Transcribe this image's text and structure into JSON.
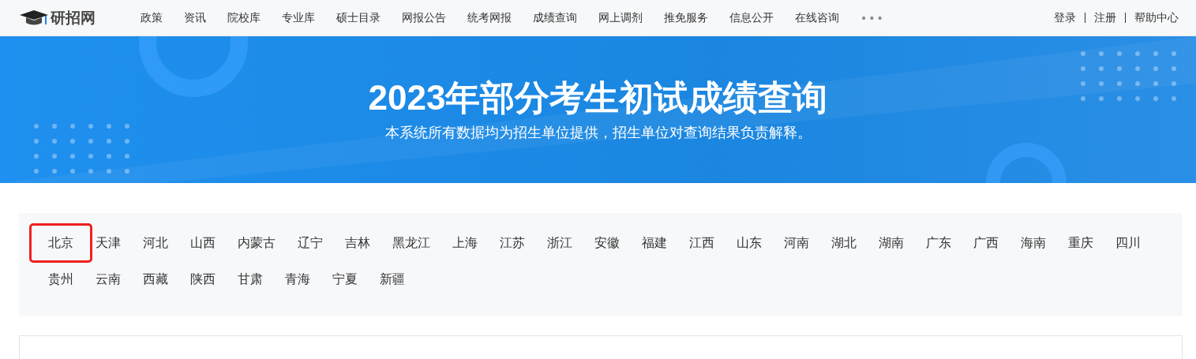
{
  "header": {
    "logo_text": "研招网",
    "nav": [
      "政策",
      "资讯",
      "院校库",
      "专业库",
      "硕士目录",
      "网报公告",
      "统考网报",
      "成绩查询",
      "网上调剂",
      "推免服务",
      "信息公开",
      "在线咨询"
    ],
    "more": "•••",
    "account_links": [
      "登录",
      "注册",
      "帮助中心"
    ]
  },
  "banner": {
    "title": "2023年部分考生初试成绩查询",
    "subtitle": "本系统所有数据均为招生单位提供，招生单位对查询结果负责解释。"
  },
  "regions": [
    {
      "name": "北京",
      "highlighted": true
    },
    {
      "name": "天津",
      "highlighted": false
    },
    {
      "name": "河北",
      "highlighted": false
    },
    {
      "name": "山西",
      "highlighted": false
    },
    {
      "name": "内蒙古",
      "highlighted": false
    },
    {
      "name": "辽宁",
      "highlighted": false
    },
    {
      "name": "吉林",
      "highlighted": false
    },
    {
      "name": "黑龙江",
      "highlighted": false
    },
    {
      "name": "上海",
      "highlighted": false
    },
    {
      "name": "江苏",
      "highlighted": false
    },
    {
      "name": "浙江",
      "highlighted": false
    },
    {
      "name": "安徽",
      "highlighted": false
    },
    {
      "name": "福建",
      "highlighted": false
    },
    {
      "name": "江西",
      "highlighted": false
    },
    {
      "name": "山东",
      "highlighted": false
    },
    {
      "name": "河南",
      "highlighted": false
    },
    {
      "name": "湖北",
      "highlighted": false
    },
    {
      "name": "湖南",
      "highlighted": false
    },
    {
      "name": "广东",
      "highlighted": false
    },
    {
      "name": "广西",
      "highlighted": false
    },
    {
      "name": "海南",
      "highlighted": false
    },
    {
      "name": "重庆",
      "highlighted": false
    },
    {
      "name": "四川",
      "highlighted": false
    },
    {
      "name": "贵州",
      "highlighted": false
    },
    {
      "name": "云南",
      "highlighted": false
    },
    {
      "name": "西藏",
      "highlighted": false
    },
    {
      "name": "陕西",
      "highlighted": false
    },
    {
      "name": "甘肃",
      "highlighted": false
    },
    {
      "name": "青海",
      "highlighted": false
    },
    {
      "name": "宁夏",
      "highlighted": false
    },
    {
      "name": "新疆",
      "highlighted": false
    }
  ]
}
